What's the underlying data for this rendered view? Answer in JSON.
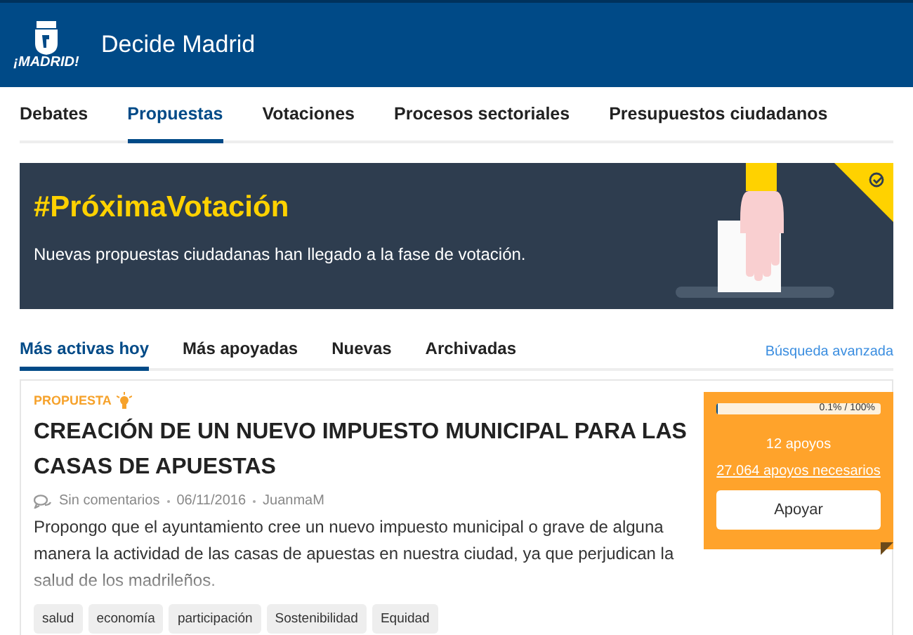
{
  "header": {
    "logo_text": "¡MADRID!",
    "title": "Decide Madrid"
  },
  "nav": [
    {
      "label": "Debates",
      "selected": false
    },
    {
      "label": "Propuestas",
      "selected": true
    },
    {
      "label": "Votaciones",
      "selected": false
    },
    {
      "label": "Procesos sectoriales",
      "selected": false
    },
    {
      "label": "Presupuestos ciudadanos",
      "selected": false
    }
  ],
  "banner": {
    "title": "#PróximaVotación",
    "text": "Nuevas propuestas ciudadanas han llegado a la fase de votación."
  },
  "filters": [
    {
      "label": "Más activas hoy",
      "selected": true
    },
    {
      "label": "Más apoyadas",
      "selected": false
    },
    {
      "label": "Nuevas",
      "selected": false
    },
    {
      "label": "Archivadas",
      "selected": false
    }
  ],
  "advanced_search": "Búsqueda avanzada",
  "proposal": {
    "category": "PROPUESTA",
    "title": "CREACIÓN DE UN NUEVO IMPUESTO MUNICIPAL PARA LAS CASAS DE APUESTAS",
    "comments": "Sin comentarios",
    "date": "06/11/2016",
    "author": "JuanmaM",
    "summary": "Propongo que el ayuntamiento cree un nuevo impuesto municipal o grave de alguna manera la actividad de las casas de apuestas en nuestra ciudad, ya que perjudican la salud de los madrileños.",
    "tags": [
      "salud",
      "economía",
      "participación",
      "Sostenibilidad",
      "Equidad"
    ],
    "support": {
      "level": 0.001,
      "progress_label": "0.1% / 100%",
      "supports": "12 apoyos",
      "needed": "27.064 apoyos necesarios",
      "button": "Apoyar"
    }
  }
}
